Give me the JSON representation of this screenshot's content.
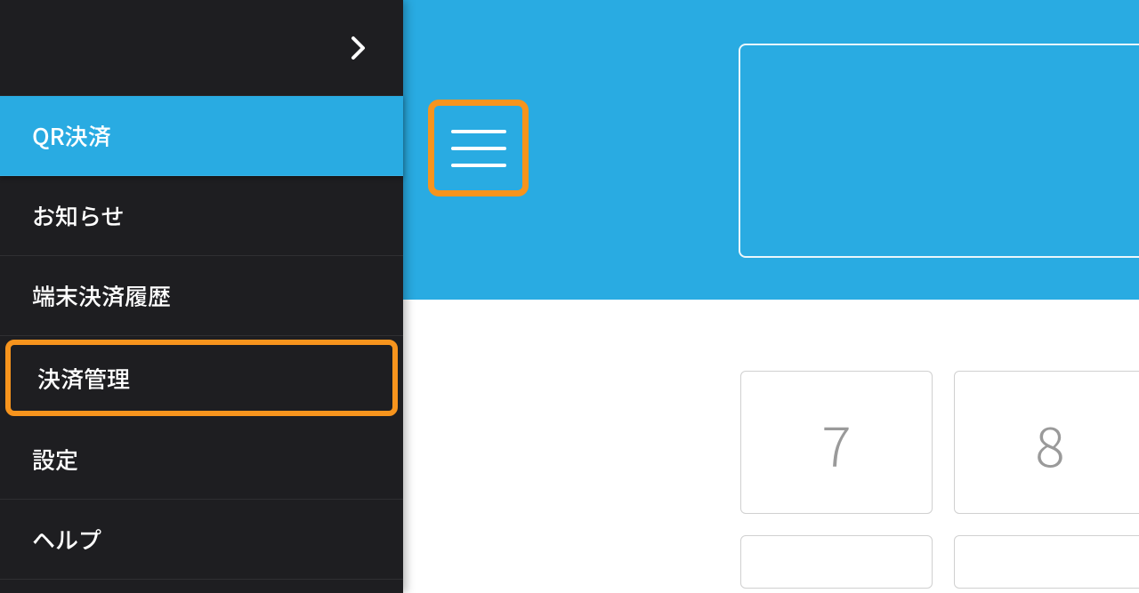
{
  "sidebar": {
    "items": [
      {
        "label": "QR決済",
        "active": true,
        "highlighted": false
      },
      {
        "label": "お知らせ",
        "active": false,
        "highlighted": false
      },
      {
        "label": "端末決済履歴",
        "active": false,
        "highlighted": false
      },
      {
        "label": "決済管理",
        "active": false,
        "highlighted": true
      },
      {
        "label": "設定",
        "active": false,
        "highlighted": false
      },
      {
        "label": "ヘルプ",
        "active": false,
        "highlighted": false
      }
    ]
  },
  "keypad": {
    "row1": [
      "7",
      "8"
    ]
  },
  "colors": {
    "accent": "#29abe2",
    "highlight": "#f7941d",
    "sidebar_bg": "#1e1e21"
  }
}
